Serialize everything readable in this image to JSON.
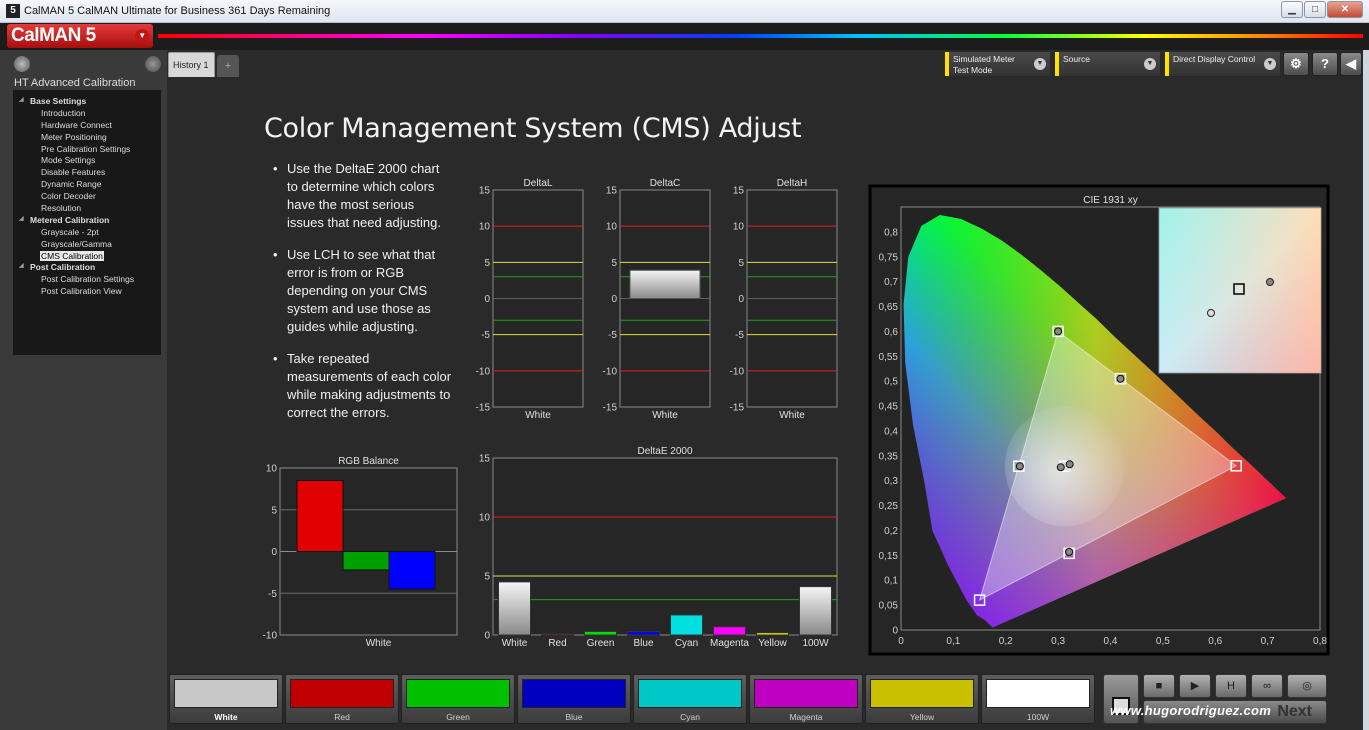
{
  "window": {
    "title": "CalMAN 5 CalMAN Ultimate for Business 361 Days Remaining",
    "app_icon": "5",
    "minimize": "▁",
    "maximize": "□",
    "close": "✕"
  },
  "header": {
    "logo": "CalMAN 5"
  },
  "sidebar": {
    "title": "HT Advanced Calibration",
    "tree": [
      {
        "type": "sec",
        "label": "Base Settings"
      },
      {
        "type": "it",
        "label": "Introduction"
      },
      {
        "type": "it",
        "label": "Hardware Connect"
      },
      {
        "type": "it",
        "label": "Meter Positioning"
      },
      {
        "type": "it",
        "label": "Pre Calibration Settings"
      },
      {
        "type": "it",
        "label": "Mode Settings"
      },
      {
        "type": "it",
        "label": "Disable Features"
      },
      {
        "type": "it",
        "label": "Dynamic Range"
      },
      {
        "type": "it",
        "label": "Color Decoder"
      },
      {
        "type": "it",
        "label": "Resolution"
      },
      {
        "type": "sec",
        "label": "Metered Calibration"
      },
      {
        "type": "it",
        "label": "Grayscale - 2pt"
      },
      {
        "type": "it",
        "label": "Grayscale/Gamma"
      },
      {
        "type": "it",
        "label": "CMS Calibration",
        "selected": true
      },
      {
        "type": "sec",
        "label": "Post Calibration"
      },
      {
        "type": "it",
        "label": "Post Calibration Settings"
      },
      {
        "type": "it",
        "label": "Post Calibration View"
      }
    ]
  },
  "tabs": {
    "history": "History 1",
    "add": "+"
  },
  "toolbar": {
    "meter_line1": "Simulated Meter",
    "meter_line2": "Test Mode",
    "source": "Source",
    "display": "Direct Display Control",
    "gear_icon": "⚙",
    "help": "?",
    "collapse": "◀"
  },
  "page": {
    "heading": "Color Management System (CMS) Adjust",
    "bullets": [
      "Use the DeltaE 2000 chart to determine which colors have the most serious issues that need adjusting.",
      "Use LCH to see what that error is from or RGB depending on your CMS system and use those as guides while adjusting.",
      "Take repeated measurements of each color while making adjustments to correct the errors."
    ]
  },
  "chart_data": [
    {
      "type": "bar",
      "title": "DeltaL",
      "categories": [
        "White"
      ],
      "values": [
        0
      ],
      "ylim": [
        -15,
        15
      ],
      "yticks": [
        "15",
        "10",
        "5",
        "0",
        "-5",
        "-10",
        "-15"
      ]
    },
    {
      "type": "bar",
      "title": "DeltaC",
      "categories": [
        "White"
      ],
      "values": [
        3.9
      ],
      "ylim": [
        -15,
        15
      ],
      "yticks": [
        "15",
        "10",
        "5",
        "0",
        "-5",
        "-10",
        "-15"
      ]
    },
    {
      "type": "bar",
      "title": "DeltaH",
      "categories": [
        "White"
      ],
      "values": [
        0
      ],
      "ylim": [
        -15,
        15
      ],
      "yticks": [
        "15",
        "10",
        "5",
        "0",
        "-5",
        "-10",
        "-15"
      ]
    },
    {
      "type": "bar",
      "title": "RGB Balance",
      "categories": [
        "White"
      ],
      "series": [
        {
          "color": "#e00000",
          "value": 8.5
        },
        {
          "color": "#00a000",
          "value": -2.2
        },
        {
          "color": "#0000ff",
          "value": -4.5
        }
      ],
      "ylim": [
        -10,
        10
      ],
      "yticks": [
        "10",
        "5",
        "0",
        "-5",
        "-10"
      ]
    },
    {
      "type": "bar",
      "title": "DeltaE 2000",
      "categories": [
        "White",
        "Red",
        "Green",
        "Blue",
        "Cyan",
        "Magenta",
        "Yellow",
        "100W"
      ],
      "values": [
        4.5,
        0.1,
        0.3,
        0.3,
        1.7,
        0.7,
        0.2,
        4.1
      ],
      "colors": [
        "#e0e0e0",
        "#ff0000",
        "#00e000",
        "#0000ff",
        "#00e0e0",
        "#ff00ff",
        "#e0e000",
        "#ffffff"
      ],
      "ylim": [
        0,
        15
      ],
      "yticks": [
        "15",
        "10",
        "5",
        "0"
      ]
    },
    {
      "type": "scatter",
      "title": "CIE 1931 xy",
      "xlim": [
        0,
        0.8
      ],
      "ylim": [
        0,
        0.85
      ],
      "xticks": [
        "0",
        "0,1",
        "0,2",
        "0,3",
        "0,4",
        "0,5",
        "0,6",
        "0,7",
        "0,8"
      ],
      "yticks": [
        "0,8",
        "0,75",
        "0,7",
        "0,65",
        "0,6",
        "0,55",
        "0,5",
        "0,45",
        "0,4",
        "0,35",
        "0,3",
        "0,25",
        "0,2",
        "0,15",
        "0,1",
        "0,05",
        "0"
      ],
      "targets": [
        [
          0.64,
          0.33
        ],
        [
          0.3,
          0.6
        ],
        [
          0.15,
          0.06
        ],
        [
          0.225,
          0.329
        ],
        [
          0.321,
          0.154
        ],
        [
          0.419,
          0.505
        ],
        [
          0.3127,
          0.329
        ]
      ],
      "measured": [
        [
          0.3,
          0.6
        ],
        [
          0.227,
          0.329
        ],
        [
          0.419,
          0.505
        ],
        [
          0.321,
          0.157
        ],
        [
          0.305,
          0.327
        ],
        [
          0.322,
          0.333
        ]
      ]
    }
  ],
  "swatches": [
    {
      "label": "White",
      "color": "#c8c8c8",
      "selected": true
    },
    {
      "label": "Red",
      "color": "#c00000"
    },
    {
      "label": "Green",
      "color": "#00c000"
    },
    {
      "label": "Blue",
      "color": "#0000c0"
    },
    {
      "label": "Cyan",
      "color": "#00c8c8"
    },
    {
      "label": "Magenta",
      "color": "#c000c0"
    },
    {
      "label": "Yellow",
      "color": "#c8c000"
    },
    {
      "label": "100W",
      "color": "#ffffff"
    }
  ],
  "controls": {
    "stop": "■",
    "play": "▶",
    "hold": "H",
    "loop": "∞",
    "next": "Next"
  },
  "watermark": "www.hugorodriguez.com"
}
